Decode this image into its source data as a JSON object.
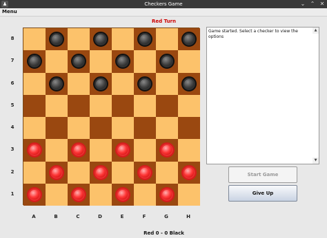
{
  "window": {
    "title": "Checkers Game",
    "icon": "app-icon",
    "controls": [
      "⌄",
      "⌃",
      "✕"
    ]
  },
  "menu": {
    "label": "Menu"
  },
  "turn": {
    "text": "Red Turn",
    "color": "#cc0000"
  },
  "board": {
    "ranks": [
      "8",
      "7",
      "6",
      "5",
      "4",
      "3",
      "2",
      "1"
    ],
    "files": [
      "A",
      "B",
      "C",
      "D",
      "E",
      "F",
      "G",
      "H"
    ],
    "rows": [
      [
        "",
        "b",
        "",
        "b",
        "",
        "b",
        "",
        "b"
      ],
      [
        "b",
        "",
        "b",
        "",
        "b",
        "",
        "b",
        ""
      ],
      [
        "",
        "b",
        "",
        "b",
        "",
        "b",
        "",
        "b"
      ],
      [
        "",
        "",
        "",
        "",
        "",
        "",
        "",
        ""
      ],
      [
        "",
        "",
        "",
        "",
        "",
        "",
        "",
        ""
      ],
      [
        "r",
        "",
        "r",
        "",
        "r",
        "",
        "r",
        ""
      ],
      [
        "",
        "r",
        "",
        "r",
        "",
        "r",
        "",
        "r"
      ],
      [
        "r",
        "",
        "r",
        "",
        "r",
        "",
        "r",
        ""
      ]
    ],
    "colors": {
      "light": "#fcc26b",
      "dark": "#9a4810",
      "red_piece": "#ff3a3a",
      "black_piece": "#2a2a2a"
    }
  },
  "log": {
    "text": "Game started. Select a checker to view the options"
  },
  "buttons": {
    "start": "Start Game",
    "give_up": "Give Up"
  },
  "score": {
    "text": "Red 0 - 0 Black"
  }
}
